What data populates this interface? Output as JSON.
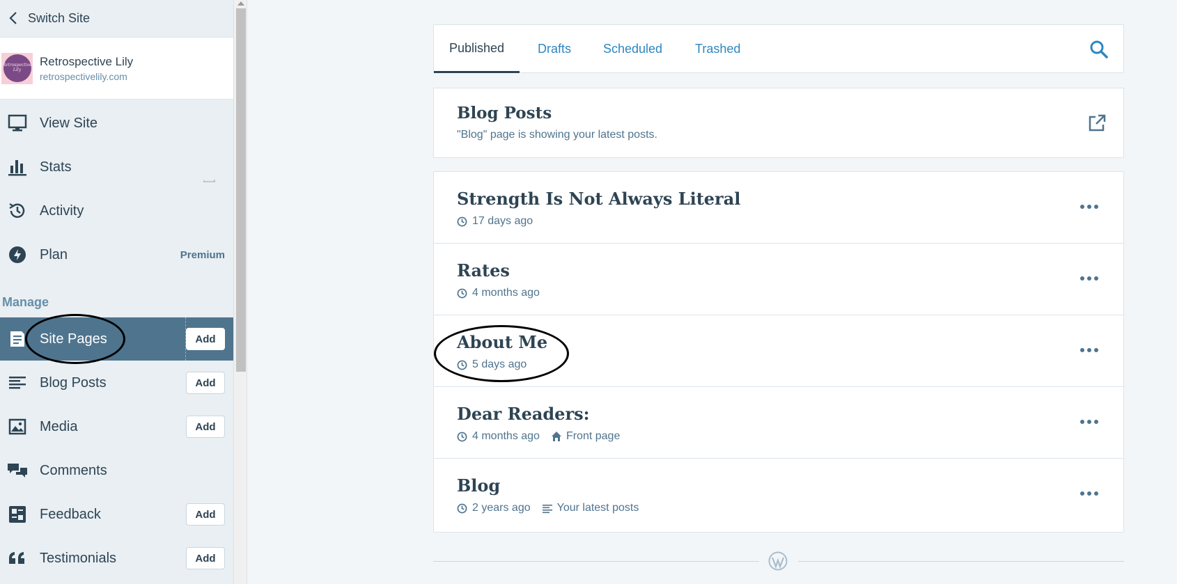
{
  "sidebar": {
    "switch_site": "Switch Site",
    "site": {
      "name": "Retrospective Lily",
      "url": "retrospectivelily.com",
      "logo_text": "Retrospective Lily"
    },
    "items": [
      {
        "label": "View Site",
        "icon": "desktop-icon"
      },
      {
        "label": "Stats",
        "icon": "stats-icon"
      },
      {
        "label": "Activity",
        "icon": "history-icon"
      },
      {
        "label": "Plan",
        "icon": "plan-icon",
        "badge": "Premium"
      }
    ],
    "manage_heading": "Manage",
    "manage_items": [
      {
        "label": "Site Pages",
        "icon": "pages-icon",
        "add": "Add",
        "active": true
      },
      {
        "label": "Blog Posts",
        "icon": "posts-icon",
        "add": "Add"
      },
      {
        "label": "Media",
        "icon": "image-icon",
        "add": "Add"
      },
      {
        "label": "Comments",
        "icon": "comments-icon"
      },
      {
        "label": "Feedback",
        "icon": "feedback-icon",
        "add": "Add"
      },
      {
        "label": "Testimonials",
        "icon": "quote-icon",
        "add": "Add"
      }
    ]
  },
  "tabs": [
    {
      "label": "Published",
      "active": true
    },
    {
      "label": "Drafts"
    },
    {
      "label": "Scheduled"
    },
    {
      "label": "Trashed"
    }
  ],
  "blog_posts_card": {
    "title": "Blog Posts",
    "description": "\"Blog\" page is showing your latest posts."
  },
  "pages": [
    {
      "title": "Strength Is Not Always Literal",
      "time": "17 days ago"
    },
    {
      "title": "Rates",
      "time": "4 months ago"
    },
    {
      "title": "About Me",
      "time": "5 days ago"
    },
    {
      "title": "Dear Readers:",
      "time": "4 months ago",
      "extra": "Front page",
      "extra_icon": "home-icon"
    },
    {
      "title": "Blog",
      "time": "2 years ago",
      "extra": "Your latest posts",
      "extra_icon": "posts-icon"
    }
  ],
  "colors": {
    "accent": "#2e86c1",
    "sidebar_bg": "#e9eff3",
    "active_bg": "#4f748e",
    "text": "#2e4453"
  }
}
